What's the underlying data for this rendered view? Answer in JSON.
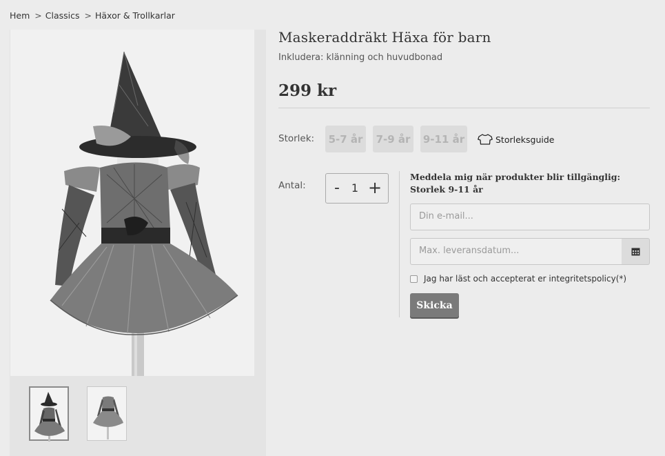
{
  "breadcrumb": {
    "sep": ">",
    "items": [
      "Hem",
      "Classics",
      "Häxor & Trollkarlar"
    ]
  },
  "product": {
    "title": "Maskeraddräkt Häxa för barn",
    "subtitle": "Inkludera: klänning och huvudbonad",
    "price": "299 kr"
  },
  "size": {
    "label": "Storlek:",
    "options": [
      "5-7 år",
      "7-9 år",
      "9-11 år"
    ],
    "guide_label": "Storleksguide",
    "guide_icon": "tshirt-icon"
  },
  "quantity": {
    "label": "Antal:",
    "minus": "-",
    "value": "1",
    "plus": "+"
  },
  "notify": {
    "title": "Meddela mig när produkter blir tillgänglig: Storlek 9-11 år",
    "email_placeholder": "Din e-mail...",
    "date_placeholder": "Max. leveransdatum...",
    "calendar_icon": "calendar-icon",
    "consent": "Jag har läst och accepterat er integritetspolicy(*)",
    "submit": "Skicka"
  },
  "colors": {
    "background": "#ececec",
    "button": "#7a7a7a",
    "size_disabled": "#dcdcdc"
  }
}
